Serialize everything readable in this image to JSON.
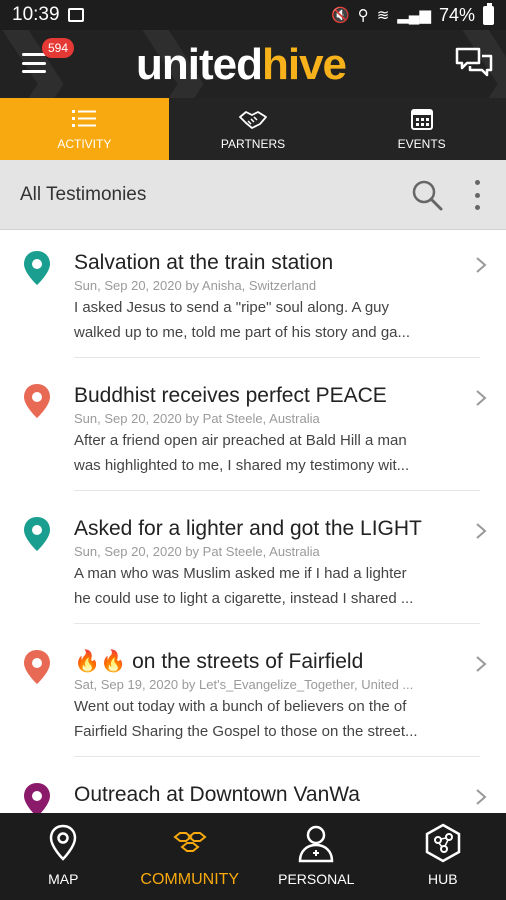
{
  "status_bar": {
    "time": "10:39",
    "battery": "74%"
  },
  "header": {
    "logo_part1": "united",
    "logo_part2": "hive",
    "notification_count": "594"
  },
  "tabs": [
    {
      "label": "ACTIVITY",
      "icon": "list-icon",
      "active": true
    },
    {
      "label": "PARTNERS",
      "icon": "handshake-icon",
      "active": false
    },
    {
      "label": "EVENTS",
      "icon": "calendar-icon",
      "active": false
    }
  ],
  "filter": {
    "title": "All Testimonies"
  },
  "items": [
    {
      "title": "Salvation at the train station",
      "meta": "Sun, Sep 20, 2020 by Anisha, Switzerland",
      "line1": "I asked Jesus to send a \"ripe\" soul along. A guy",
      "line2": "walked up to me, told me part of his story and ga...",
      "pin_color": "#1a9e8f"
    },
    {
      "title": "Buddhist receives perfect PEACE",
      "meta": "Sun, Sep 20, 2020 by Pat Steele, Australia",
      "line1": "After a friend open air preached at Bald Hill a man",
      "line2": "was highlighted to me, I shared my testimony wit...",
      "pin_color": "#e86a55"
    },
    {
      "title": "Asked for a lighter and got the LIGHT",
      "meta": "Sun, Sep 20, 2020 by Pat Steele, Australia",
      "line1": "A man who was Muslim asked me if I had a lighter",
      "line2": "he could use to light a cigarette, instead I shared ...",
      "pin_color": "#1a9e8f"
    },
    {
      "title": "🔥🔥 on the streets of Fairfield",
      "meta": "Sat, Sep 19, 2020 by Let's_Evangelize_Together, United ...",
      "line1": "Went out today with a bunch of believers on the of",
      "line2": "Fairfield Sharing the Gospel to those on the street...",
      "pin_color": "#e86a55"
    },
    {
      "title": "Outreach at Downtown VanWa",
      "meta": "",
      "line1": "",
      "line2": "",
      "pin_color": "#8b1a6b"
    }
  ],
  "bottom_nav": [
    {
      "label": "MAP",
      "icon": "map-pin-icon",
      "active": false
    },
    {
      "label": "COMMUNITY",
      "icon": "hexagons-icon",
      "active": true
    },
    {
      "label": "PERSONAL",
      "icon": "person-icon",
      "active": false
    },
    {
      "label": "HUB",
      "icon": "hub-icon",
      "active": false
    }
  ],
  "colors": {
    "accent": "#f7a90f",
    "header_bg": "#222222",
    "filter_bg": "#e4e4e4"
  }
}
